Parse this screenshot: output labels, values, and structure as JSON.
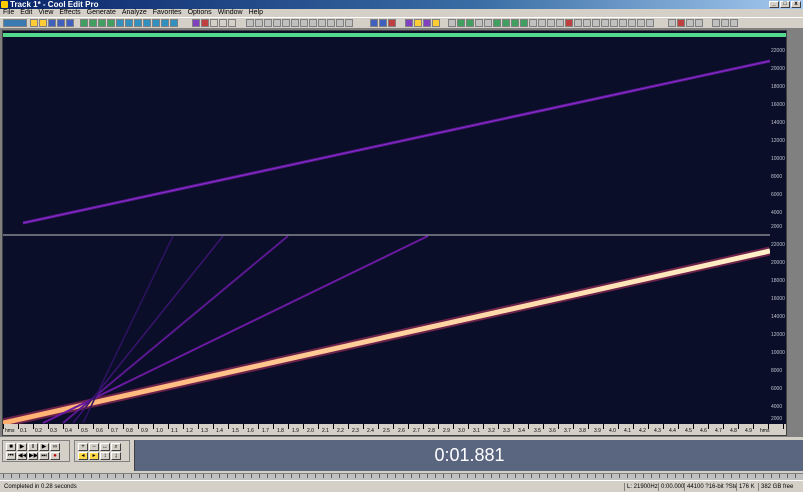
{
  "window": {
    "title": "Track 1* - Cool Edit Pro",
    "min_label": "_",
    "max_label": "□",
    "close_label": "x"
  },
  "menu": [
    "File",
    "Edit",
    "View",
    "Effects",
    "Generate",
    "Analyze",
    "Favorites",
    "Options",
    "Window",
    "Help"
  ],
  "vertical_scale": {
    "top": [
      "22000",
      "20000",
      "18000",
      "16000",
      "14000",
      "12000",
      "10000",
      "8000",
      "6000",
      "4000",
      "2000"
    ],
    "bottom": [
      "22000",
      "20000",
      "18000",
      "16000",
      "14000",
      "12000",
      "10000",
      "8000",
      "6000",
      "4000",
      "2000"
    ]
  },
  "timeline": {
    "labels": [
      "hms",
      "0.1",
      "0.2",
      "0.3",
      "0.4",
      "0.5",
      "0.6",
      "0.7",
      "0.8",
      "0.9",
      "1.0",
      "1.1",
      "1.2",
      "1.3",
      "1.4",
      "1.5",
      "1.6",
      "1.7",
      "1.8",
      "1.9",
      "2.0",
      "2.1",
      "2.2",
      "2.3",
      "2.4",
      "2.5",
      "2.6",
      "2.7",
      "2.8",
      "2.9",
      "3.0",
      "3.1",
      "3.2",
      "3.3",
      "3.4",
      "3.5",
      "3.6",
      "3.7",
      "3.8",
      "3.9",
      "4.0",
      "4.1",
      "4.2",
      "4.3",
      "4.4",
      "4.5",
      "4.6",
      "4.7",
      "4.8",
      "4.9",
      "hms"
    ]
  },
  "time_display": "0:01.881",
  "statusbar": {
    "message": "Completed in 0.28 seconds",
    "rate": "L: 21900Hz @",
    "position": "0:00.000",
    "format": "44100 ?16-bit ?Stereo",
    "size": "176 K",
    "free": "382 GB free"
  },
  "colors": {
    "background": "#0a0e28",
    "overview_bar": "#54d98c",
    "sweep": "#ffd9a0",
    "harmonic": "#6a1aa0"
  }
}
